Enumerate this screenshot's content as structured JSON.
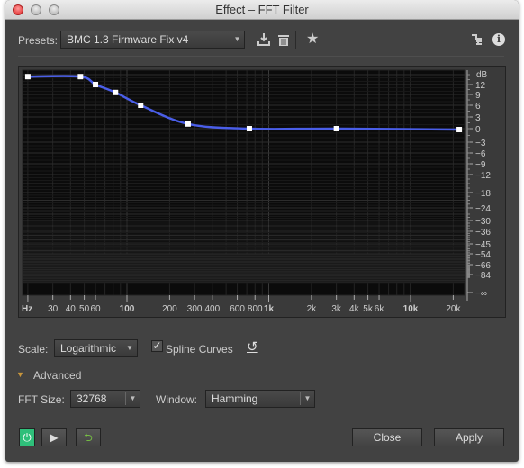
{
  "window": {
    "title": "Effect – FFT Filter"
  },
  "presets": {
    "label": "Presets:",
    "value": "BMC 1.3 Firmware Fix v4"
  },
  "icons": {
    "save": "save-preset-icon",
    "delete": "trash-icon",
    "favorite": "star-icon",
    "routing": "channel-routing-icon",
    "info": "info-icon"
  },
  "chart_data": {
    "type": "line",
    "xlabel": "Hz",
    "ylabel": "dB",
    "x_scale": "log",
    "x_ticks": [
      "30",
      "40",
      "50",
      "60",
      "100",
      "200",
      "300",
      "400",
      "600",
      "800",
      "1k",
      "2k",
      "3k",
      "4k",
      "5k",
      "6k",
      "10k",
      "20k"
    ],
    "x_tick_values": [
      30,
      40,
      50,
      60,
      100,
      200,
      300,
      400,
      600,
      800,
      1000,
      2000,
      3000,
      4000,
      5000,
      6000,
      10000,
      20000
    ],
    "y_ticks": [
      "12",
      "9",
      "6",
      "3",
      "0",
      "−3",
      "−6",
      "−9",
      "−12",
      "−18",
      "−24",
      "−30",
      "−36",
      "−45",
      "−54",
      "−66",
      "−84",
      "−∞"
    ],
    "control_points": [
      {
        "hz": 20,
        "db": 14.4
      },
      {
        "hz": 47,
        "db": 14.4
      },
      {
        "hz": 60,
        "db": 12
      },
      {
        "hz": 83,
        "db": 9.6
      },
      {
        "hz": 125,
        "db": 6
      },
      {
        "hz": 270,
        "db": 1.2
      },
      {
        "hz": 730,
        "db": 0
      },
      {
        "hz": 3000,
        "db": 0
      },
      {
        "hz": 22050,
        "db": -0.2
      }
    ],
    "line_color": "#4a5ee8",
    "grid": true
  },
  "controls": {
    "scale_label": "Scale:",
    "scale_value": "Logarithmic",
    "spline_label": "Spline Curves",
    "spline_checked": true,
    "advanced_label": "Advanced",
    "fft_label": "FFT Size:",
    "fft_value": "32768",
    "window_label": "Window:",
    "window_value": "Hamming"
  },
  "footer": {
    "close": "Close",
    "apply": "Apply"
  },
  "colors": {
    "power_on": "#2fbf7a",
    "loop": "#7ac943",
    "advanced_triangle": "#c8963c"
  }
}
